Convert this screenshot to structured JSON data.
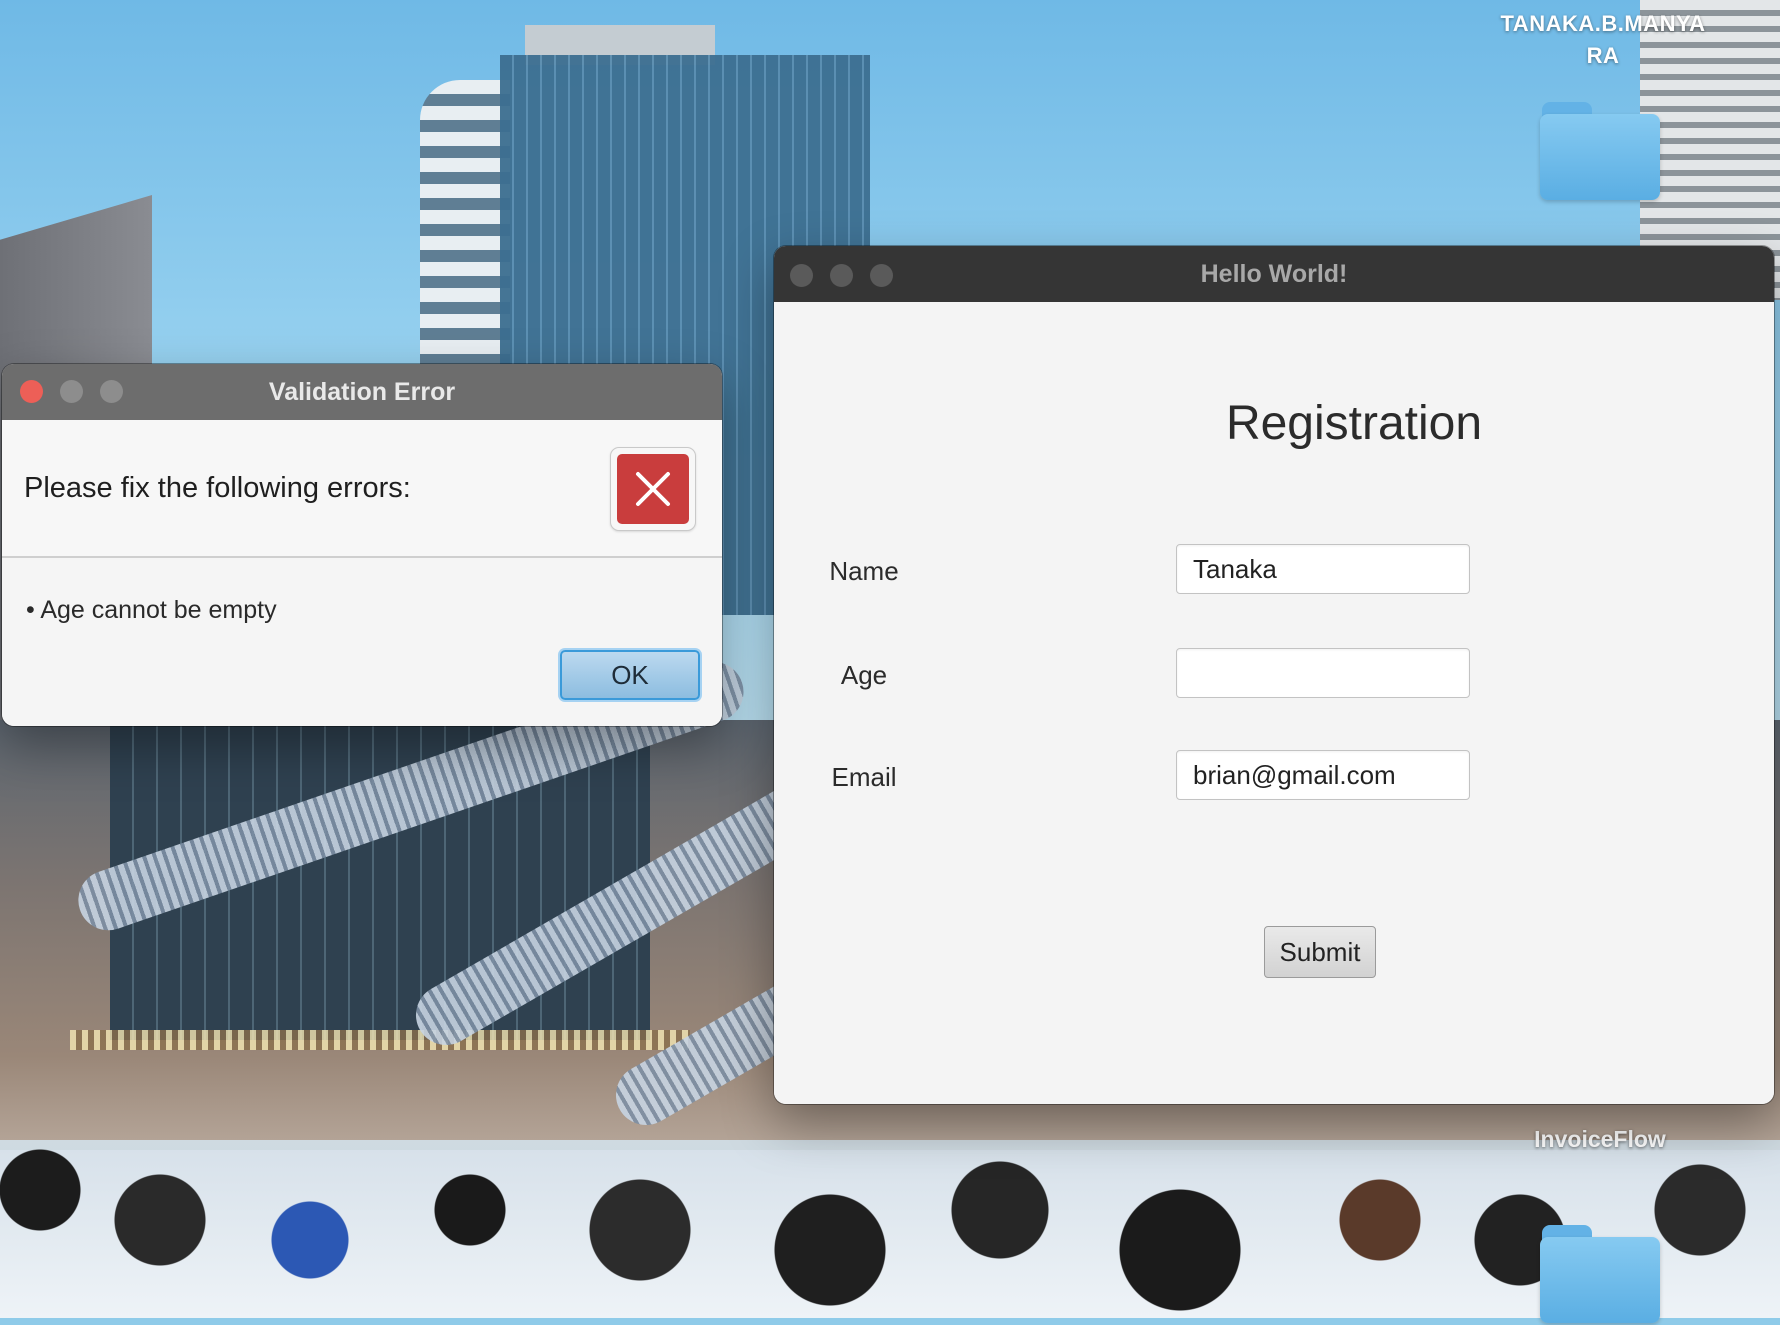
{
  "desktop": {
    "user_label": "TANAKA.B.MANYARA",
    "icons": [
      {
        "name": "folder-icon",
        "label": ""
      },
      {
        "name": "folder-icon",
        "label": "InvoiceFlow"
      }
    ]
  },
  "validation_dialog": {
    "title": "Validation Error",
    "message": "Please fix the following errors:",
    "icon": "error-x-icon",
    "errors": [
      "• Age cannot be empty"
    ],
    "ok_label": "OK"
  },
  "main_window": {
    "title": "Hello World!",
    "heading": "Registration",
    "fields": [
      {
        "label": "Name",
        "value": "Tanaka"
      },
      {
        "label": "Age",
        "value": ""
      },
      {
        "label": "Email",
        "value": "brian@gmail.com"
      }
    ],
    "submit_label": "Submit"
  },
  "colors": {
    "traffic_close": "#ed5f57",
    "traffic_inactive": "#5a5a5a",
    "error_red": "#c93d3d",
    "ok_border": "#3a9ad9"
  }
}
